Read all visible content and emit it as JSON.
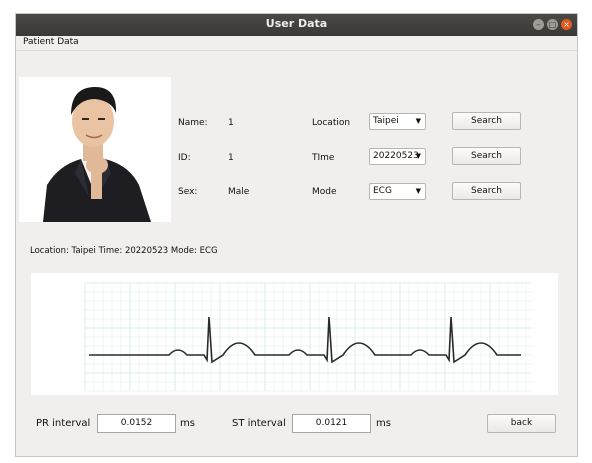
{
  "window": {
    "title": "User Data"
  },
  "menu": {
    "patient_data": "Patient Data"
  },
  "patient": {
    "name_label": "Name:",
    "name": "1",
    "id_label": "ID:",
    "id": "1",
    "sex_label": "Sex:",
    "sex": "Male"
  },
  "filters": {
    "location_label": "Location",
    "location_value": "Taipei",
    "time_label": "TIme",
    "time_value": "20220523",
    "mode_label": "Mode",
    "mode_value": "ECG",
    "search_label": "Search"
  },
  "status": {
    "location_label": "Location:",
    "location": "Taipei",
    "time_label": "Time:",
    "time": "20220523",
    "mode_label": "Mode:",
    "mode": "ECG"
  },
  "intervals": {
    "pr_label": "PR interval",
    "pr_value": "0.0152",
    "pr_unit": "ms",
    "st_label": "ST interval",
    "st_value": "0.0121",
    "st_unit": "ms"
  },
  "actions": {
    "back_label": "back"
  },
  "colors": {
    "grid": "#d9ece6",
    "trace": "#2a2a2a",
    "close": "#e3581f"
  }
}
